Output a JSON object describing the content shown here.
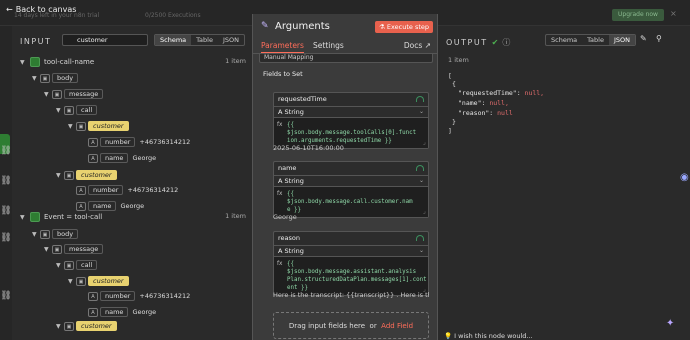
{
  "topbar": {
    "back_label": "Back to canvas",
    "trial_text": "14 days left in your n8n trial",
    "exec_text": "0/2500 Executions",
    "upgrade_label": "Upgrade now"
  },
  "input": {
    "title": "INPUT",
    "search_value": "customer",
    "tabs": [
      "Schema",
      "Table",
      "JSON"
    ],
    "active_tab": "Schema",
    "nodes": [
      {
        "name": "tool-call-name",
        "items": "1 item"
      },
      {
        "name": "Event = tool-call",
        "items": "1 item"
      }
    ],
    "keys": {
      "body": "body",
      "message": "message",
      "call": "call",
      "customer": "customer",
      "number": "number",
      "name": "name"
    },
    "values": {
      "number": "+46736314212",
      "name": "George"
    }
  },
  "args": {
    "title": "Arguments",
    "execute_label": "Execute step",
    "tabs": [
      "Parameters",
      "Settings"
    ],
    "active_tab": "Parameters",
    "docs_label": "Docs",
    "mode_value": "Manual Mapping",
    "fields_label": "Fields to Set",
    "fields": [
      {
        "name": "requestedTime",
        "type": "String",
        "expr_lines": [
          "{{ $json.body.message.toolCalls[0].funct",
          "ion.arguments.requestedTime }}"
        ],
        "result": "2025-06-10T16:00:00"
      },
      {
        "name": "name",
        "type": "String",
        "expr_lines": [
          "{{ $json.body.message.call.customer.nam",
          "e }}"
        ],
        "result": "George"
      },
      {
        "name": "reason",
        "type": "String",
        "expr_lines": [
          "{{ $json.body.message.assistant.analysis",
          "Plan.structuredDataPlan.messages[1].cont",
          "ent }}"
        ],
        "result": "Here is the transcript: {{transcript}} . Here is the ende..."
      }
    ],
    "drag_text": "Drag input fields here",
    "or_text": "or",
    "add_field_label": "Add Field"
  },
  "output": {
    "title": "OUTPUT",
    "tabs": [
      "Schema",
      "Table",
      "JSON"
    ],
    "active_tab": "JSON",
    "items": "1 item",
    "json_lines": {
      "open_bracket": "[",
      "open_brace": "{",
      "key1": "\"requestedTime\": ",
      "key2": "\"name\": ",
      "key3": "\"reason\": ",
      "null_comma": "null,",
      "null": "null",
      "close_brace": "}",
      "close_bracket": "]"
    },
    "feedback": "I wish this node would..."
  },
  "colors": {
    "accent": "#ff6d5a",
    "execute": "#e8614d",
    "node_green": "#2e7d32",
    "highlight": "#e8d270",
    "expr_green": "#8fd9a8",
    "null_red": "#e06c6c"
  }
}
